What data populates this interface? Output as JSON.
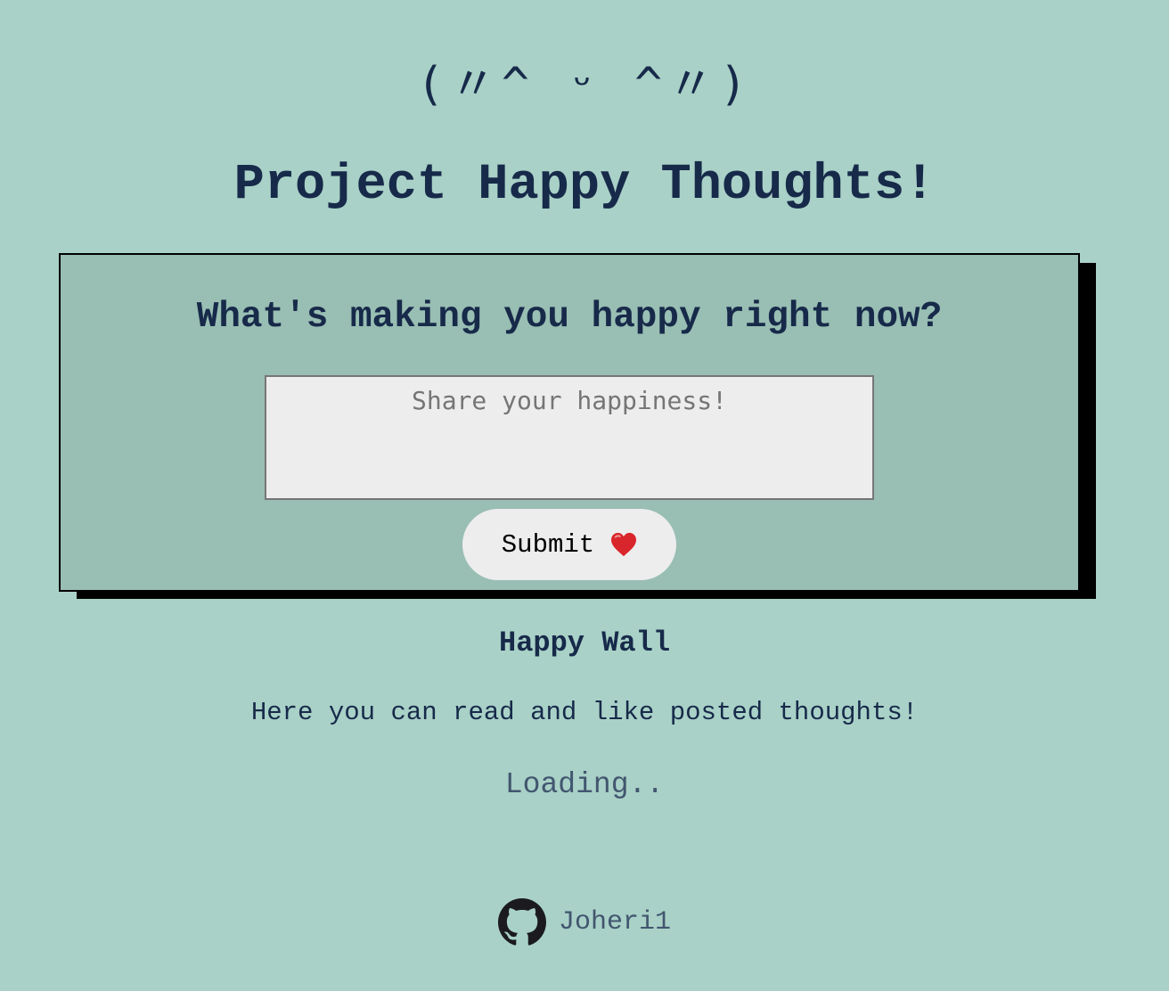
{
  "colors": {
    "page_background": "#a9d1c7",
    "card_background": "#99beb3",
    "card_shadow": "#000000",
    "text_primary": "#172a4a",
    "text_muted": "#42566f",
    "input_background": "#ededed",
    "button_background": "#ededed",
    "heart": "#d9262c"
  },
  "header": {
    "emoticon": "(〃^ ᵕ ^〃)",
    "title": "Project Happy Thoughts!"
  },
  "form": {
    "question": "What's making you happy right now?",
    "input_placeholder": "Share your happiness!",
    "input_value": "",
    "submit_label": "Submit",
    "submit_icon": "heart-icon"
  },
  "wall": {
    "title": "Happy Wall",
    "description": "Here you can read and like posted thoughts!",
    "loading_text": "Loading.."
  },
  "footer": {
    "icon": "github-icon",
    "username": "Joheri1"
  }
}
